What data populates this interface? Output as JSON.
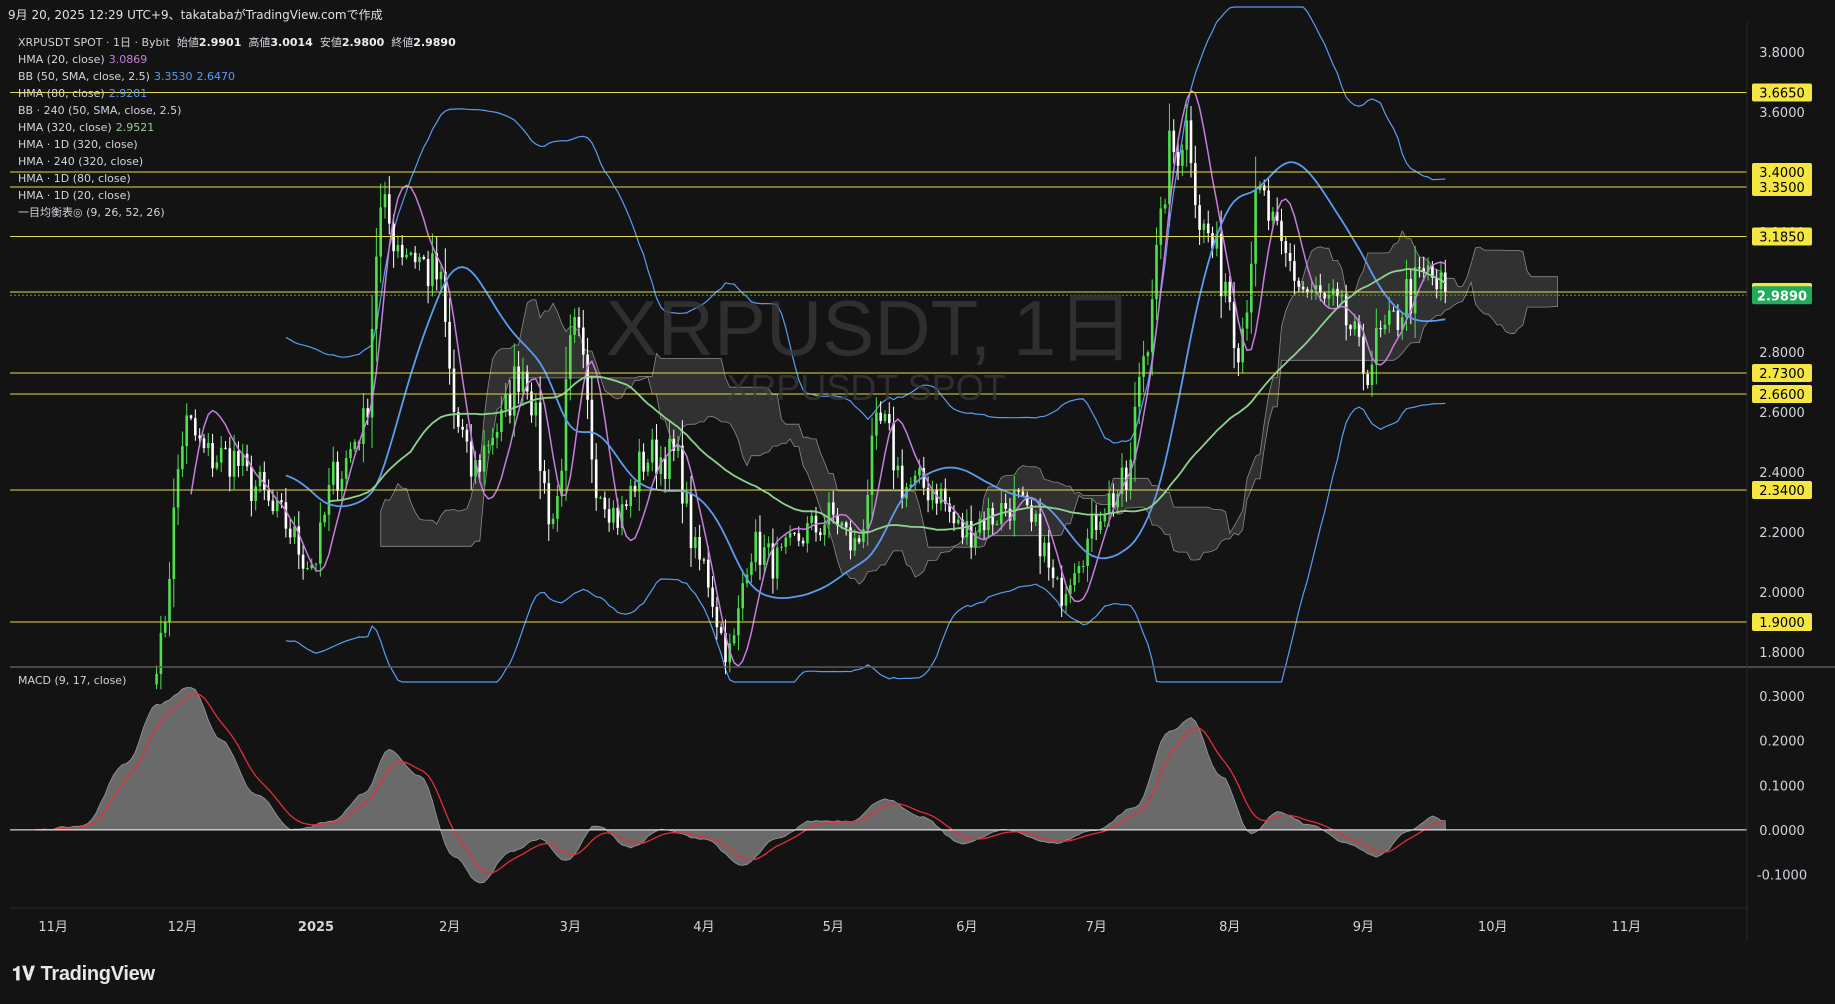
{
  "header": {
    "text": "9月 20, 2025 12:29 UTC+9、takatabaがTradingView.comで作成"
  },
  "legend": {
    "symbol_line": {
      "label": "XRPUSDT SPOT · 1日 · Bybit",
      "open_label": "始値",
      "open": "2.9901",
      "high_label": "高値",
      "high": "3.0014",
      "low_label": "安値",
      "low": "2.9800",
      "close_label": "終値",
      "close": "2.9890"
    },
    "indicators": [
      {
        "label": "HMA (20, close)",
        "value": "3.0869",
        "color": "#c77dde"
      },
      {
        "label": "BB (50, SMA, close, 2.5)",
        "value": "3.3530",
        "value2": "2.6470",
        "color": "#5b9cf2"
      },
      {
        "label": "HMA (80, close)",
        "value": "2.9201",
        "color": "#5b9cf2"
      },
      {
        "label": "BB · 240 (50, SMA, close, 2.5)",
        "value": "",
        "color": ""
      },
      {
        "label": "HMA (320, close)",
        "value": "2.9521",
        "color": "#8fd18f"
      },
      {
        "label": "HMA · 1D (320, close)",
        "value": "",
        "color": ""
      },
      {
        "label": "HMA · 240 (320, close)",
        "value": "",
        "color": ""
      },
      {
        "label": "HMA · 1D (80, close)",
        "value": "",
        "color": ""
      },
      {
        "label": "HMA · 1D (20, close)",
        "value": "",
        "color": ""
      },
      {
        "label": "一目均衡表◎ (9, 26, 52, 26)",
        "value": "",
        "color": ""
      }
    ]
  },
  "watermark": {
    "main": "XRPUSDT, 1日",
    "sub": "XRPUSDT SPOT"
  },
  "macd_title": "MACD (9, 17, close)",
  "logo": {
    "text": "TradingView",
    "icon": "tradingview-logo-icon"
  },
  "colors": {
    "up": "#4ee04e",
    "down": "#ffffff",
    "hline": "#e6d94a",
    "label_bg": "#f5e642",
    "last_price_bg": "#22ab5a",
    "hma20": "#c77dde",
    "bb50": "#5b9cf2",
    "hma320": "#8fd18f",
    "macd_signal": "#e0303a",
    "macd_hist": "#7a7a7a"
  },
  "chart_data": [
    {
      "type": "candlestick",
      "title": "",
      "ylim": [
        1.75,
        3.9
      ],
      "y_ticks": [
        "3.8000",
        "3.6000",
        "3.4000",
        "3.2000",
        "3.0000",
        "2.8000",
        "2.6000",
        "2.4000",
        "2.2000",
        "2.0000",
        "1.8000"
      ],
      "x_labels": [
        {
          "label": "11月",
          "date": "2024-11-01"
        },
        {
          "label": "12月",
          "date": "2024-12-01"
        },
        {
          "label": "2025",
          "date": "2025-01-01"
        },
        {
          "label": "2月",
          "date": "2025-02-01"
        },
        {
          "label": "3月",
          "date": "2025-03-01"
        },
        {
          "label": "4月",
          "date": "2025-04-01"
        },
        {
          "label": "5月",
          "date": "2025-05-01"
        },
        {
          "label": "6月",
          "date": "2025-06-01"
        },
        {
          "label": "7月",
          "date": "2025-07-01"
        },
        {
          "label": "8月",
          "date": "2025-08-01"
        },
        {
          "label": "9月",
          "date": "2025-09-01"
        },
        {
          "label": "10月",
          "date": "2025-10-01"
        },
        {
          "label": "11月",
          "date": "2025-11-01"
        }
      ],
      "x_range": [
        "2024-10-22",
        "2025-11-29"
      ],
      "horizontal_lines": [
        "3.6650",
        "3.4000",
        "3.3500",
        "3.1850",
        "3.0000",
        "2.7300",
        "2.6600",
        "2.3400",
        "1.9000"
      ],
      "last_price": "2.9890",
      "price_anchors": [
        [
          "2024-11-25",
          1.78
        ],
        [
          "2024-12-02",
          2.55
        ],
        [
          "2024-12-07",
          2.45
        ],
        [
          "2024-12-12",
          2.45
        ],
        [
          "2024-12-18",
          2.35
        ],
        [
          "2024-12-23",
          2.25
        ],
        [
          "2024-12-31",
          2.1
        ],
        [
          "2025-01-06",
          2.4
        ],
        [
          "2025-01-12",
          2.55
        ],
        [
          "2025-01-16",
          3.25
        ],
        [
          "2025-01-22",
          3.15
        ],
        [
          "2025-01-29",
          3.05
        ],
        [
          "2025-02-03",
          2.55
        ],
        [
          "2025-02-06",
          2.4
        ],
        [
          "2025-02-12",
          2.55
        ],
        [
          "2025-02-18",
          2.75
        ],
        [
          "2025-02-25",
          2.25
        ],
        [
          "2025-03-02",
          2.85
        ],
        [
          "2025-03-08",
          2.35
        ],
        [
          "2025-03-12",
          2.25
        ],
        [
          "2025-03-19",
          2.45
        ],
        [
          "2025-03-25",
          2.45
        ],
        [
          "2025-03-31",
          2.1
        ],
        [
          "2025-04-07",
          1.8
        ],
        [
          "2025-04-12",
          2.15
        ],
        [
          "2025-04-18",
          2.1
        ],
        [
          "2025-04-25",
          2.2
        ],
        [
          "2025-05-01",
          2.25
        ],
        [
          "2025-05-06",
          2.15
        ],
        [
          "2025-05-12",
          2.55
        ],
        [
          "2025-05-18",
          2.35
        ],
        [
          "2025-05-24",
          2.35
        ],
        [
          "2025-05-31",
          2.2
        ],
        [
          "2025-06-06",
          2.25
        ],
        [
          "2025-06-12",
          2.3
        ],
        [
          "2025-06-17",
          2.2
        ],
        [
          "2025-06-22",
          2.0
        ],
        [
          "2025-06-28",
          2.15
        ],
        [
          "2025-07-03",
          2.3
        ],
        [
          "2025-07-08",
          2.35
        ],
        [
          "2025-07-12",
          2.8
        ],
        [
          "2025-07-15",
          3.1
        ],
        [
          "2025-07-18",
          3.45
        ],
        [
          "2025-07-22",
          3.55
        ],
        [
          "2025-07-26",
          3.2
        ],
        [
          "2025-07-31",
          3.05
        ],
        [
          "2025-08-03",
          2.85
        ],
        [
          "2025-08-08",
          3.3
        ],
        [
          "2025-08-14",
          3.1
        ],
        [
          "2025-08-19",
          3.0
        ],
        [
          "2025-08-24",
          2.95
        ],
        [
          "2025-08-28",
          2.9
        ],
        [
          "2025-09-01",
          2.75
        ],
        [
          "2025-09-06",
          2.85
        ],
        [
          "2025-09-12",
          3.0
        ],
        [
          "2025-09-16",
          3.05
        ],
        [
          "2025-09-20",
          2.989
        ]
      ]
    },
    {
      "type": "area",
      "title": "",
      "ylim": [
        -0.175,
        0.365
      ],
      "y_ticks": [
        "0.3000",
        "0.2000",
        "0.1000",
        "0.0000",
        "-0.1000"
      ],
      "series": [
        {
          "name": "",
          "anchors": [
            [
              "2024-10-28",
              0.0
            ],
            [
              "2024-11-08",
              0.01
            ],
            [
              "2024-11-18",
              0.15
            ],
            [
              "2024-11-25",
              0.28
            ],
            [
              "2024-12-03",
              0.32
            ],
            [
              "2024-12-10",
              0.2
            ],
            [
              "2024-12-18",
              0.08
            ],
            [
              "2024-12-27",
              0.0
            ],
            [
              "2025-01-05",
              0.02
            ],
            [
              "2025-01-12",
              0.08
            ],
            [
              "2025-01-18",
              0.18
            ],
            [
              "2025-01-25",
              0.12
            ],
            [
              "2025-02-02",
              -0.06
            ],
            [
              "2025-02-08",
              -0.12
            ],
            [
              "2025-02-15",
              -0.05
            ],
            [
              "2025-02-22",
              -0.02
            ],
            [
              "2025-02-28",
              -0.07
            ],
            [
              "2025-03-07",
              0.01
            ],
            [
              "2025-03-15",
              -0.04
            ],
            [
              "2025-03-22",
              0.0
            ],
            [
              "2025-04-01",
              -0.02
            ],
            [
              "2025-04-10",
              -0.08
            ],
            [
              "2025-04-18",
              -0.02
            ],
            [
              "2025-04-26",
              0.02
            ],
            [
              "2025-05-05",
              0.02
            ],
            [
              "2025-05-13",
              0.07
            ],
            [
              "2025-05-21",
              0.03
            ],
            [
              "2025-05-31",
              -0.03
            ],
            [
              "2025-06-10",
              0.0
            ],
            [
              "2025-06-21",
              -0.03
            ],
            [
              "2025-07-01",
              0.0
            ],
            [
              "2025-07-10",
              0.05
            ],
            [
              "2025-07-18",
              0.22
            ],
            [
              "2025-07-23",
              0.25
            ],
            [
              "2025-07-30",
              0.12
            ],
            [
              "2025-08-06",
              -0.01
            ],
            [
              "2025-08-12",
              0.04
            ],
            [
              "2025-08-20",
              0.01
            ],
            [
              "2025-08-28",
              -0.03
            ],
            [
              "2025-09-04",
              -0.06
            ],
            [
              "2025-09-12",
              0.0
            ],
            [
              "2025-09-17",
              0.03
            ],
            [
              "2025-09-20",
              0.02
            ]
          ]
        }
      ]
    }
  ]
}
